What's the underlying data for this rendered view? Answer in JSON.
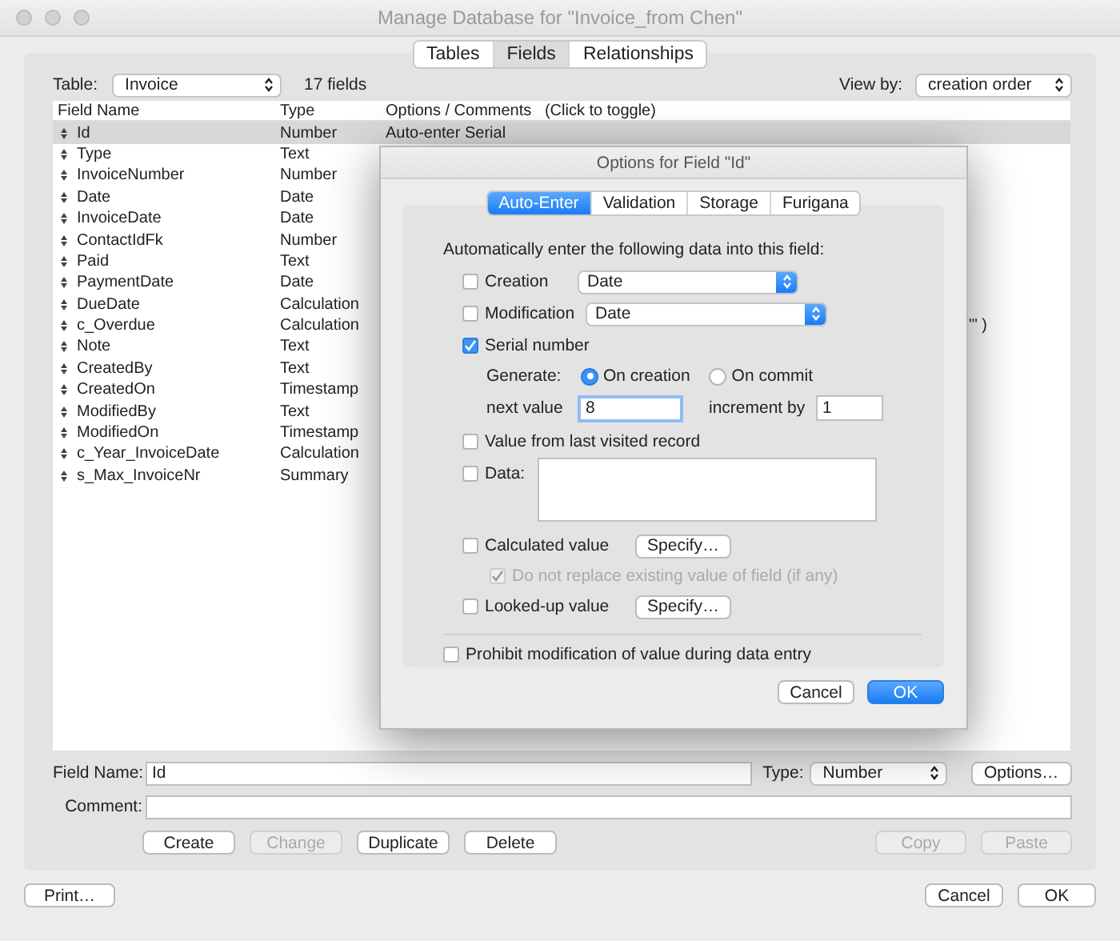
{
  "window": {
    "title": "Manage Database for \"Invoice_from Chen\""
  },
  "tabs": [
    {
      "label": "Tables",
      "selected": false
    },
    {
      "label": "Fields",
      "selected": true
    },
    {
      "label": "Relationships",
      "selected": false
    }
  ],
  "table_select": {
    "label": "Table:",
    "value": "Invoice"
  },
  "field_count": "17 fields",
  "view_by": {
    "label": "View by:",
    "value": "creation order"
  },
  "columns": [
    "Field Name",
    "Type",
    "Options / Comments   (Click to toggle)"
  ],
  "rows": [
    {
      "name": "Id",
      "type": "Number",
      "options": "Auto-enter Serial",
      "selected": true
    },
    {
      "name": "Type",
      "type": "Text",
      "selected": false
    },
    {
      "name": "InvoiceNumber",
      "type": "Number",
      "selected": false
    },
    {
      "name": "Date",
      "type": "Date",
      "selected": false
    },
    {
      "name": "InvoiceDate",
      "type": "Date",
      "selected": false
    },
    {
      "name": "ContactIdFk",
      "type": "Number",
      "selected": false
    },
    {
      "name": "Paid",
      "type": "Text",
      "selected": false
    },
    {
      "name": "PaymentDate",
      "type": "Date",
      "selected": false
    },
    {
      "name": "DueDate",
      "type": "Calculation",
      "selected": false
    },
    {
      "name": "c_Overdue",
      "type": "Calculation",
      "options_tail": "\"\" )",
      "selected": false
    },
    {
      "name": "Note",
      "type": "Text",
      "selected": false
    },
    {
      "name": "CreatedBy",
      "type": "Text",
      "selected": false
    },
    {
      "name": "CreatedOn",
      "type": "Timestamp",
      "selected": false
    },
    {
      "name": "ModifiedBy",
      "type": "Text",
      "selected": false
    },
    {
      "name": "ModifiedOn",
      "type": "Timestamp",
      "selected": false
    },
    {
      "name": "c_Year_InvoiceDate",
      "type": "Calculation",
      "selected": false
    },
    {
      "name": "s_Max_InvoiceNr",
      "type": "Summary",
      "selected": false
    }
  ],
  "field_name": {
    "label": "Field Name:",
    "value": "Id"
  },
  "type_select": {
    "label": "Type:",
    "value": "Number"
  },
  "options_button": "Options…",
  "comment": {
    "label": "Comment:"
  },
  "actions": [
    {
      "label": "Create",
      "disabled": false
    },
    {
      "label": "Change",
      "disabled": true
    },
    {
      "label": "Duplicate",
      "disabled": false
    },
    {
      "label": "Delete",
      "disabled": false
    }
  ],
  "clipboard": [
    {
      "label": "Copy",
      "disabled": true
    },
    {
      "label": "Paste",
      "disabled": true
    }
  ],
  "print_button": "Print…",
  "footer_buttons": [
    "Cancel",
    "OK"
  ],
  "dialog": {
    "title": "Options for Field \"Id\"",
    "tabs": [
      {
        "label": "Auto-Enter",
        "selected": true
      },
      {
        "label": "Validation",
        "selected": false
      },
      {
        "label": "Storage",
        "selected": false
      },
      {
        "label": "Furigana",
        "selected": false
      }
    ],
    "intro": "Automatically enter the following data into this field:",
    "creation": {
      "label": "Creation",
      "checked": false,
      "value": "Date"
    },
    "modification": {
      "label": "Modification",
      "checked": false,
      "value": "Date"
    },
    "serial": {
      "label": "Serial number",
      "checked": true,
      "generate_label": "Generate:",
      "generate_options": [
        {
          "label": "On creation",
          "selected": true
        },
        {
          "label": "On commit",
          "selected": false
        }
      ],
      "next_label": "next value",
      "next_value": "8",
      "increment_label": "increment by",
      "increment_value": "1"
    },
    "last_visited": {
      "label": "Value from last visited record",
      "checked": false
    },
    "data": {
      "label": "Data:",
      "checked": false
    },
    "calculated": {
      "label": "Calculated value",
      "checked": false,
      "button": "Specify…"
    },
    "do_not_replace": {
      "label": "Do not replace existing value of field (if any)",
      "checked": true,
      "disabled": true
    },
    "looked_up": {
      "label": "Looked-up value",
      "checked": false,
      "button": "Specify…"
    },
    "prohibit": {
      "label": "Prohibit modification of value during data entry",
      "checked": false
    },
    "buttons": [
      {
        "label": "Cancel",
        "default": false
      },
      {
        "label": "OK",
        "default": true
      }
    ]
  }
}
